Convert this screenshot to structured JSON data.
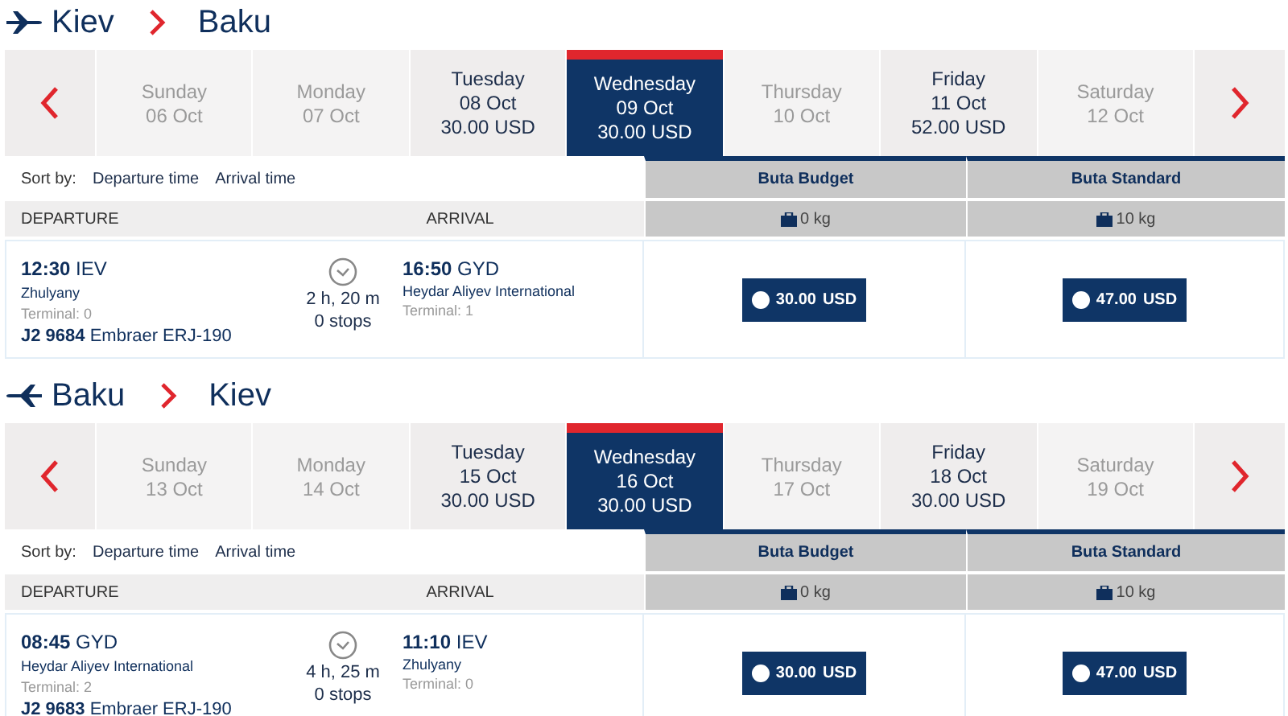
{
  "legs": [
    {
      "kind": "outbound",
      "from": "Kiev",
      "to": "Baku",
      "days": [
        {
          "day": "Sunday",
          "date": "06 Oct",
          "available": false,
          "selected": false
        },
        {
          "day": "Monday",
          "date": "07 Oct",
          "available": false,
          "selected": false
        },
        {
          "day": "Tuesday",
          "date": "08 Oct",
          "price": "30.00 USD",
          "available": true,
          "selected": false
        },
        {
          "day": "Wednesday",
          "date": "09 Oct",
          "price": "30.00 USD",
          "available": true,
          "selected": true
        },
        {
          "day": "Thursday",
          "date": "10 Oct",
          "available": false,
          "selected": false
        },
        {
          "day": "Friday",
          "date": "11 Oct",
          "price": "52.00 USD",
          "available": true,
          "selected": false
        },
        {
          "day": "Saturday",
          "date": "12 Oct",
          "available": false,
          "selected": false
        }
      ],
      "sort_label": "Sort by:",
      "sort_options": [
        "Departure time",
        "Arrival time"
      ],
      "columns": [
        "DEPARTURE",
        "ARRIVAL"
      ],
      "fares": [
        {
          "name": "Buta Budget",
          "baggage": "0 kg"
        },
        {
          "name": "Buta Standard",
          "baggage": "10 kg"
        }
      ],
      "flight": {
        "dep_time": "12:30",
        "dep_code": "IEV",
        "dep_airport": "Zhulyany",
        "dep_terminal": "Terminal: 0",
        "flight_no": "J2 9684",
        "aircraft": "Embraer ERJ-190",
        "duration": "2 h, 20 m",
        "stops": "0 stops",
        "arr_time": "16:50",
        "arr_code": "GYD",
        "arr_airport": "Heydar Aliyev International",
        "arr_terminal": "Terminal: 1",
        "prices": [
          {
            "amount": "30.00",
            "currency": "USD"
          },
          {
            "amount": "47.00",
            "currency": "USD"
          }
        ]
      }
    },
    {
      "kind": "inbound",
      "from": "Baku",
      "to": "Kiev",
      "days": [
        {
          "day": "Sunday",
          "date": "13 Oct",
          "available": false,
          "selected": false
        },
        {
          "day": "Monday",
          "date": "14 Oct",
          "available": false,
          "selected": false
        },
        {
          "day": "Tuesday",
          "date": "15 Oct",
          "price": "30.00 USD",
          "available": true,
          "selected": false
        },
        {
          "day": "Wednesday",
          "date": "16 Oct",
          "price": "30.00 USD",
          "available": true,
          "selected": true
        },
        {
          "day": "Thursday",
          "date": "17 Oct",
          "available": false,
          "selected": false
        },
        {
          "day": "Friday",
          "date": "18 Oct",
          "price": "30.00 USD",
          "available": true,
          "selected": false
        },
        {
          "day": "Saturday",
          "date": "19 Oct",
          "available": false,
          "selected": false
        }
      ],
      "sort_label": "Sort by:",
      "sort_options": [
        "Departure time",
        "Arrival time"
      ],
      "columns": [
        "DEPARTURE",
        "ARRIVAL"
      ],
      "fares": [
        {
          "name": "Buta Budget",
          "baggage": "0 kg"
        },
        {
          "name": "Buta Standard",
          "baggage": "10 kg"
        }
      ],
      "flight": {
        "dep_time": "08:45",
        "dep_code": "GYD",
        "dep_airport": "Heydar Aliyev International",
        "dep_terminal": "Terminal: 2",
        "flight_no": "J2 9683",
        "aircraft": "Embraer ERJ-190",
        "duration": "4 h, 25 m",
        "stops": "0 stops",
        "arr_time": "11:10",
        "arr_code": "IEV",
        "arr_airport": "Zhulyany",
        "arr_terminal": "Terminal: 0",
        "prices": [
          {
            "amount": "30.00",
            "currency": "USD"
          },
          {
            "amount": "47.00",
            "currency": "USD"
          }
        ]
      }
    }
  ]
}
